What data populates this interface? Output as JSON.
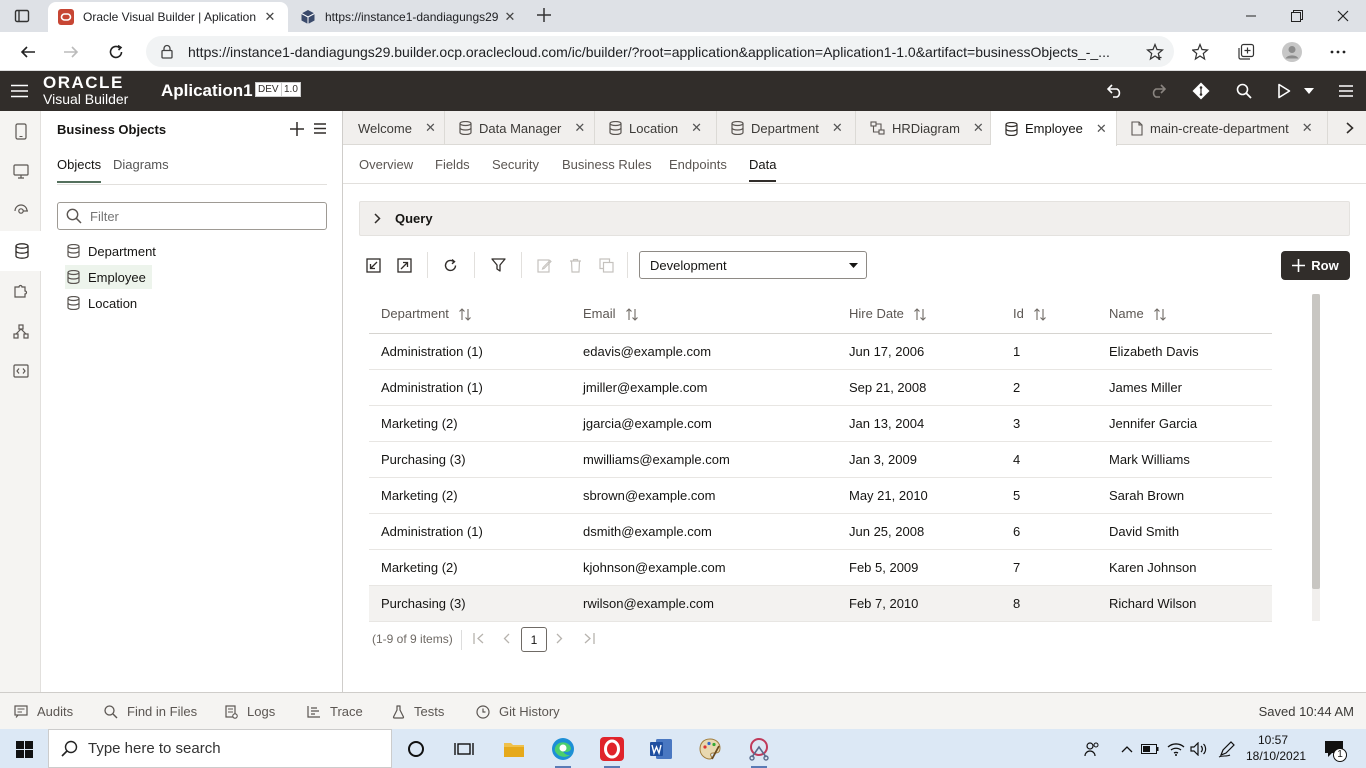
{
  "browser": {
    "tabs": [
      {
        "title": "Oracle Visual Builder | Aplication"
      },
      {
        "title": "https://instance1-dandiagungs29"
      }
    ],
    "url": "https://instance1-dandiagungs29.builder.ocp.oraclecloud.com/ic/builder/?root=application&application=Aplication1-1.0&artifact=businessObjects_-_..."
  },
  "vb": {
    "logo_line1": "ORACLE",
    "logo_line2": "Visual Builder",
    "app_name": "Aplication1",
    "env_badge": "DEV",
    "version_badge": "1.0"
  },
  "business_objects": {
    "title": "Business Objects",
    "tabs": [
      "Objects",
      "Diagrams"
    ],
    "filter_placeholder": "Filter",
    "items": [
      "Department",
      "Employee",
      "Location"
    ]
  },
  "editor_tabs": [
    "Welcome",
    "Data Manager",
    "Location",
    "Department",
    "HRDiagram",
    "Employee",
    "main-create-department"
  ],
  "sub_nav": [
    "Overview",
    "Fields",
    "Security",
    "Business Rules",
    "Endpoints",
    "Data"
  ],
  "query_label": "Query",
  "environment": "Development",
  "row_button": "Row",
  "table": {
    "columns": [
      "Department",
      "Email",
      "Hire Date",
      "Id",
      "Name"
    ],
    "rows": [
      [
        "Administration (1)",
        "edavis@example.com",
        "Jun 17, 2006",
        "1",
        "Elizabeth Davis"
      ],
      [
        "Administration (1)",
        "jmiller@example.com",
        "Sep 21, 2008",
        "2",
        "James Miller"
      ],
      [
        "Marketing (2)",
        "jgarcia@example.com",
        "Jan 13, 2004",
        "3",
        "Jennifer Garcia"
      ],
      [
        "Purchasing (3)",
        "mwilliams@example.com",
        "Jan 3, 2009",
        "4",
        "Mark Williams"
      ],
      [
        "Marketing (2)",
        "sbrown@example.com",
        "May 21, 2010",
        "5",
        "Sarah Brown"
      ],
      [
        "Administration (1)",
        "dsmith@example.com",
        "Jun 25, 2008",
        "6",
        "David Smith"
      ],
      [
        "Marketing (2)",
        "kjohnson@example.com",
        "Feb 5, 2009",
        "7",
        "Karen Johnson"
      ],
      [
        "Purchasing (3)",
        "rwilson@example.com",
        "Feb 7, 2010",
        "8",
        "Richard Wilson"
      ]
    ]
  },
  "pagination": {
    "info": "(1-9 of 9 items)",
    "current_page": "1"
  },
  "status_bar": {
    "items": [
      "Audits",
      "Find in Files",
      "Logs",
      "Trace",
      "Tests",
      "Git History"
    ],
    "saved": "Saved 10:44 AM"
  },
  "taskbar": {
    "search_placeholder": "Type here to search",
    "time": "10:57",
    "date": "18/10/2021",
    "notification_count": "1"
  },
  "colors": {
    "header_bg": "#312d2a",
    "accent_green": "#54705d",
    "oracle_red": "#c74634"
  }
}
